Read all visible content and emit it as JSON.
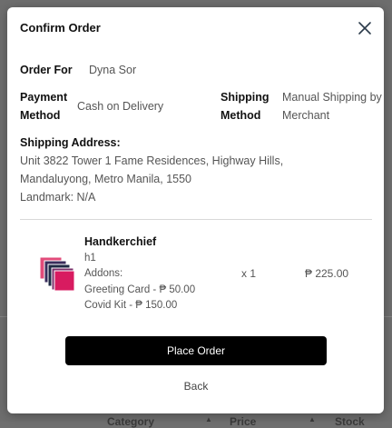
{
  "background": {
    "table_headers": [
      "Category",
      "Price",
      "Stock"
    ]
  },
  "modal": {
    "title": "Confirm Order",
    "close_icon": "close-icon"
  },
  "order": {
    "order_for_label": "Order For",
    "order_for_value": "Dyna Sor",
    "payment_method_label": "Payment Method",
    "payment_method_value": "Cash on Delivery",
    "shipping_method_label": "Shipping Method",
    "shipping_method_value": "Manual Shipping by Merchant",
    "shipping_address_label": "Shipping Address:",
    "shipping_address_value": "Unit 3822 Tower 1 Fame Residences, Highway Hills, Mandaluyong, Metro Manila, 1550",
    "landmark": "Landmark: N/A"
  },
  "product": {
    "name": "Handkerchief",
    "variant": "h1",
    "addons_label": "Addons:",
    "addons": [
      "Greeting Card - ₱ 50.00",
      "Covid Kit - ₱ 150.00"
    ],
    "quantity": "x 1",
    "price": "₱ 225.00",
    "thumb_colors": [
      "#e24b7a",
      "#c2185b",
      "#3a2d5c",
      "#1f2a44",
      "#d81b60"
    ]
  },
  "actions": {
    "place_order_label": "Place Order",
    "back_label": "Back"
  },
  "colors": {
    "primary_button": "#000000",
    "overlay": "rgba(0,0,0,0.55)"
  }
}
